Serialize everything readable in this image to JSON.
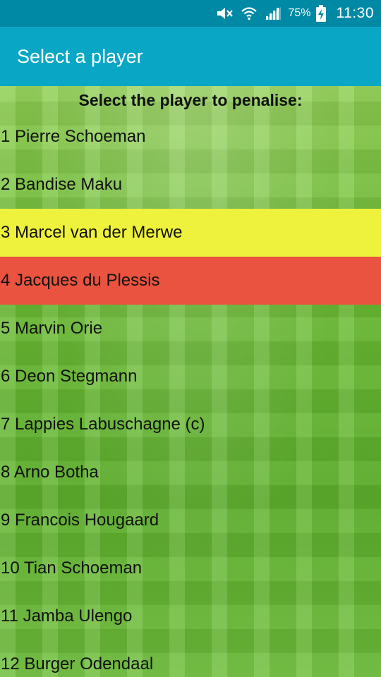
{
  "status_bar": {
    "battery_percent": "75%",
    "time": "11:30",
    "icons": [
      "mute-icon",
      "wifi-icon",
      "signal-icon",
      "battery-charging-icon"
    ]
  },
  "app_bar": {
    "title": "Select a player"
  },
  "content": {
    "prompt": "Select the player to penalise:",
    "players": [
      {
        "label": "1 Pierre Schoeman",
        "highlight": ""
      },
      {
        "label": "2 Bandise Maku",
        "highlight": ""
      },
      {
        "label": "3 Marcel van der Merwe",
        "highlight": "yellow"
      },
      {
        "label": "4 Jacques du Plessis",
        "highlight": "red"
      },
      {
        "label": "5 Marvin Orie",
        "highlight": ""
      },
      {
        "label": "6 Deon Stegmann",
        "highlight": ""
      },
      {
        "label": "7 Lappies Labuschagne (c)",
        "highlight": ""
      },
      {
        "label": "8 Arno Botha",
        "highlight": ""
      },
      {
        "label": "9 Francois Hougaard",
        "highlight": ""
      },
      {
        "label": "10 Tian Schoeman",
        "highlight": ""
      },
      {
        "label": "11 Jamba Ulengo",
        "highlight": ""
      },
      {
        "label": "12 Burger Odendaal",
        "highlight": ""
      }
    ]
  },
  "colors": {
    "status_bar": "#0089a5",
    "app_bar": "#0aa6c5",
    "highlight_yellow": "#eef23c",
    "highlight_red": "#e9533f"
  }
}
